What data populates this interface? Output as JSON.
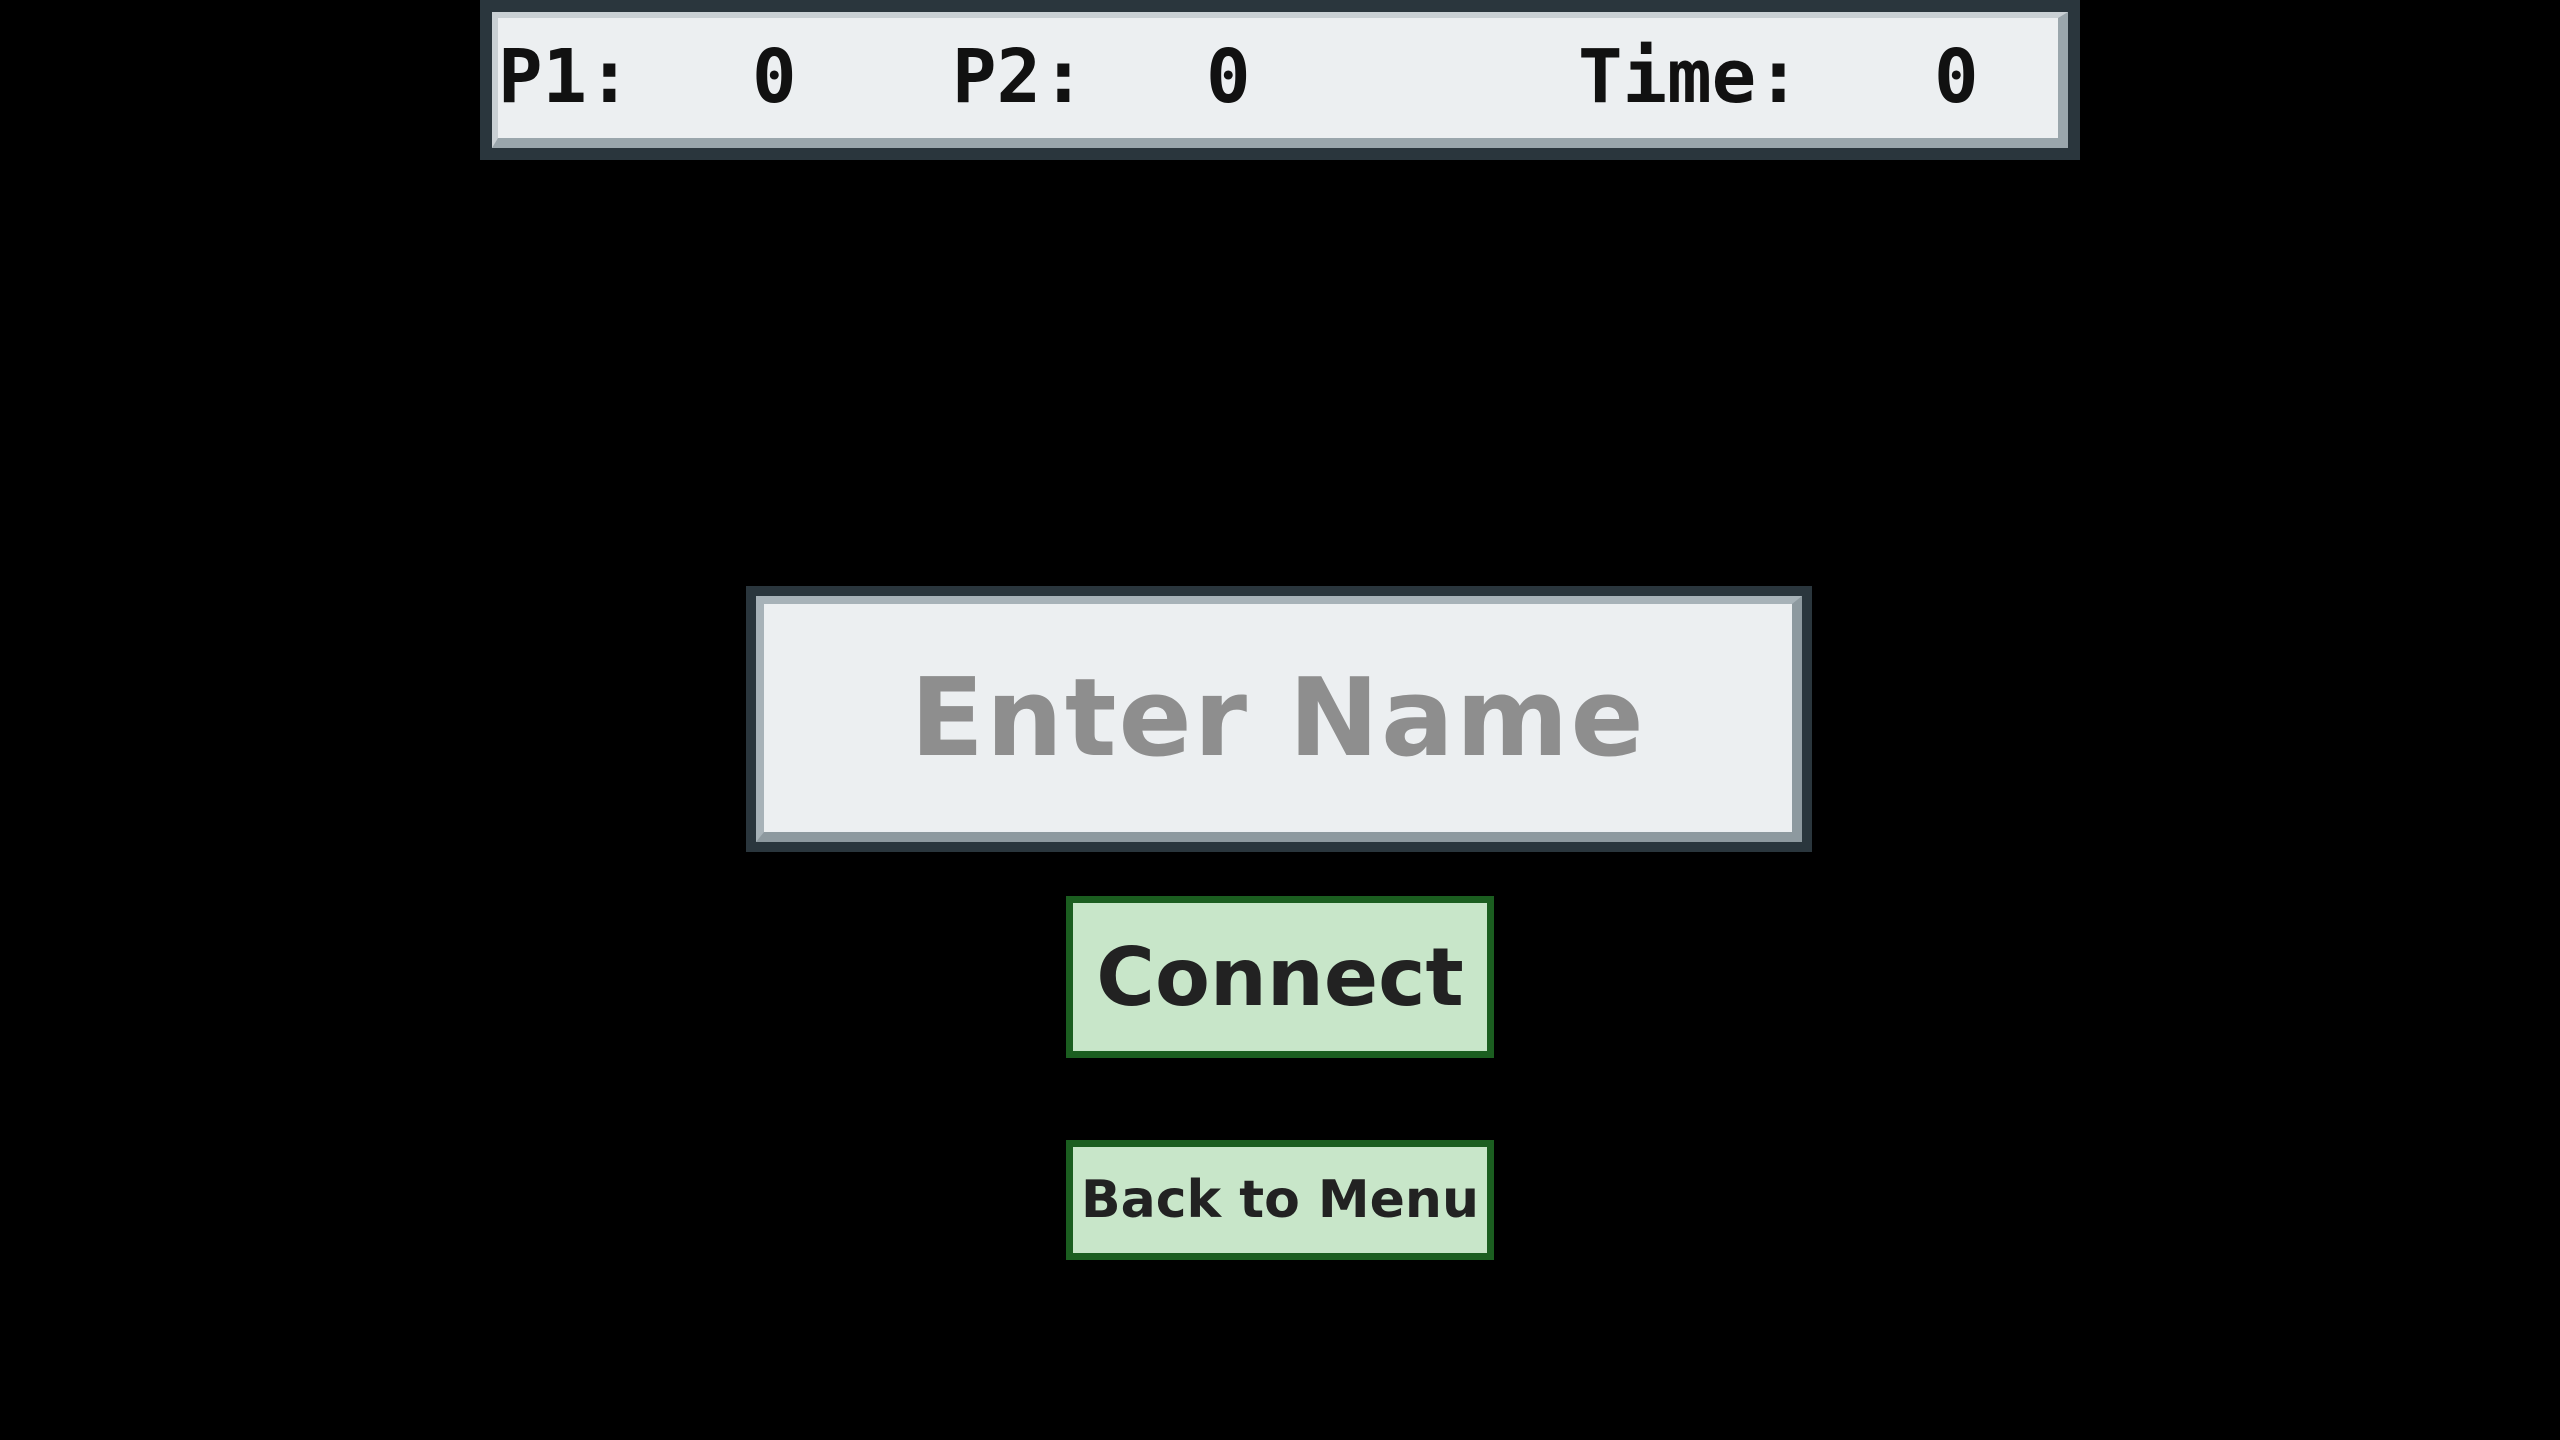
{
  "hud": {
    "p1_label": "P1:",
    "p1_score": "0",
    "p2_label": "P2:",
    "p2_score": "0",
    "time_label": "Time:",
    "time_value": "0"
  },
  "name_input": {
    "placeholder": "Enter Name",
    "value": ""
  },
  "buttons": {
    "connect": "Connect",
    "back_to_menu": "Back to Menu"
  },
  "colors": {
    "background": "#000000",
    "panel_fill": "#eceff1",
    "panel_frame": "#2a363d",
    "button_fill": "#c8e6c9",
    "button_border": "#1b5e20",
    "placeholder_text": "#8e8e8e"
  }
}
